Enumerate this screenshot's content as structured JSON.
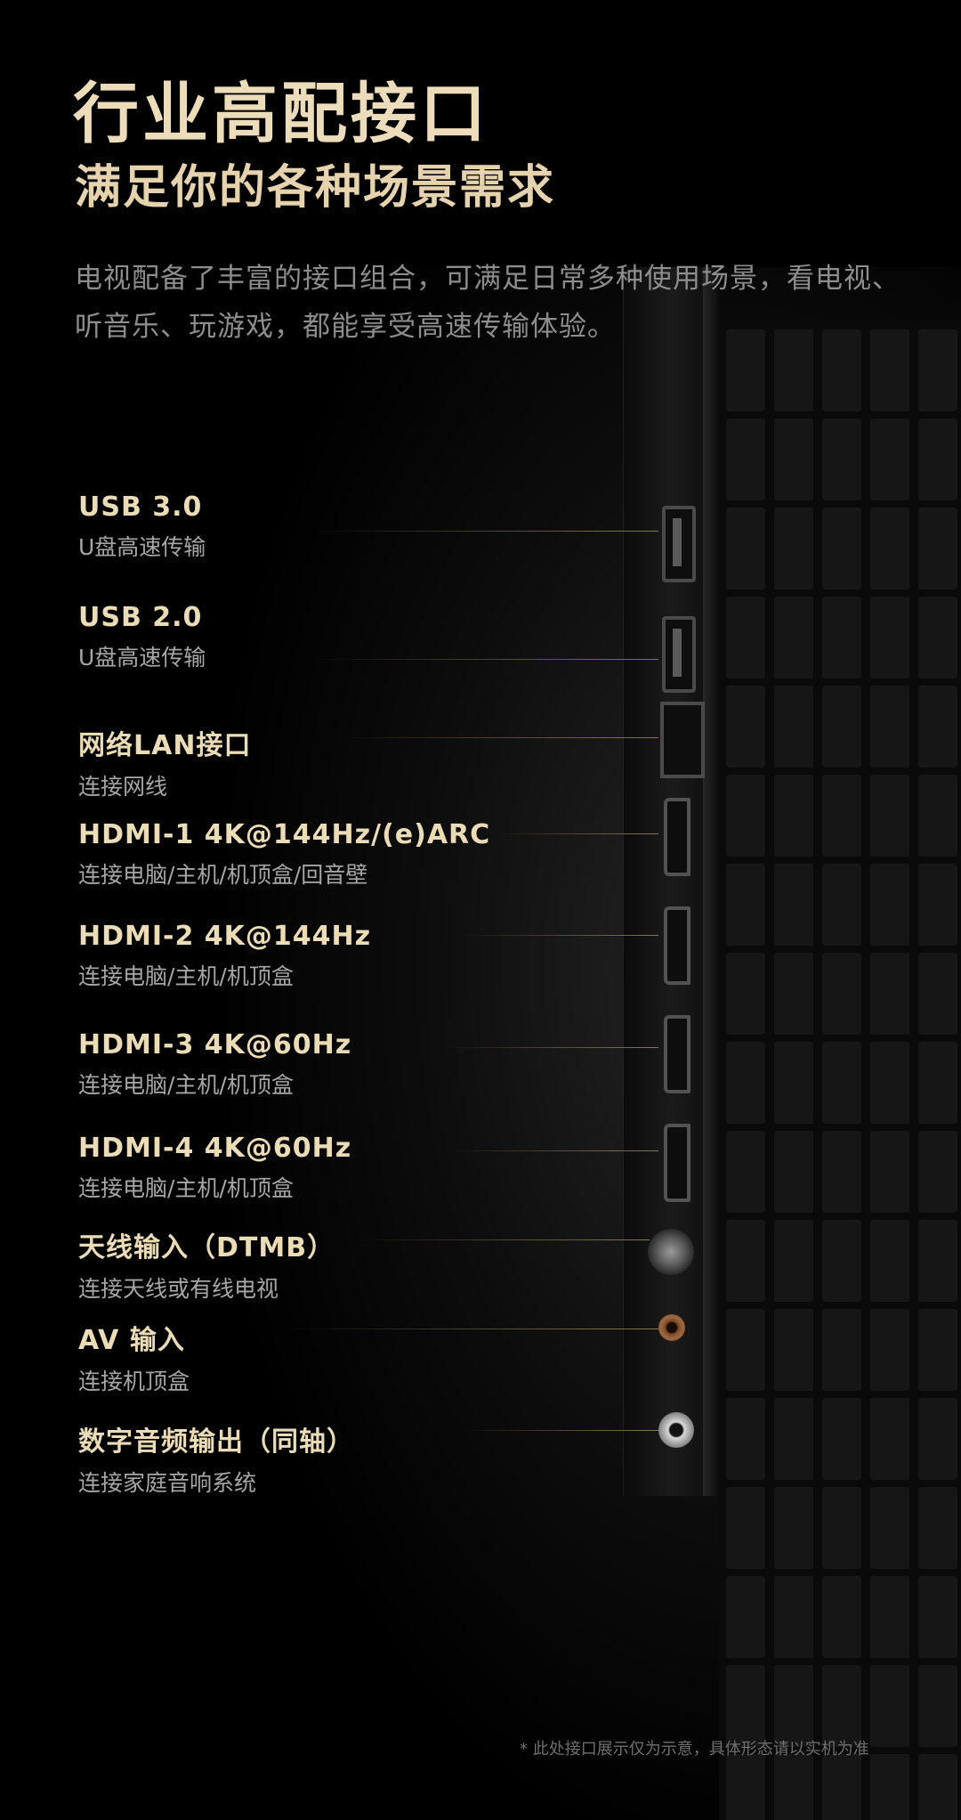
{
  "hero": {
    "title": "行业高配接口",
    "subtitle": "满足你的各种场景需求",
    "description": "电视配备了丰富的接口组合，可满足日常多种使用场景，看电视、听音乐、玩游戏，都能享受高速传输体验。"
  },
  "ports": [
    {
      "name": "USB 3.0",
      "desc": "U盘高速传输",
      "icon": "usb-port-icon"
    },
    {
      "name": "USB 2.0",
      "desc": "U盘高速传输",
      "icon": "usb-port-icon"
    },
    {
      "name": "网络LAN接口",
      "desc": "连接网线",
      "icon": "lan-port-icon"
    },
    {
      "name": "HDMI-1 4K@144Hz/(e)ARC",
      "desc": "连接电脑/主机/机顶盒/回音壁",
      "icon": "hdmi-port-icon"
    },
    {
      "name": "HDMI-2 4K@144Hz",
      "desc": "连接电脑/主机/机顶盒",
      "icon": "hdmi-port-icon"
    },
    {
      "name": "HDMI-3 4K@60Hz",
      "desc": "连接电脑/主机/机顶盒",
      "icon": "hdmi-port-icon"
    },
    {
      "name": "HDMI-4 4K@60Hz",
      "desc": "连接电脑/主机/机顶盒",
      "icon": "hdmi-port-icon"
    },
    {
      "name": "天线输入（DTMB）",
      "desc": "连接天线或有线电视",
      "icon": "antenna-port-icon"
    },
    {
      "name": "AV 输入",
      "desc": "连接机顶盒",
      "icon": "av-port-icon"
    },
    {
      "name": "数字音频输出（同轴）",
      "desc": "连接家庭音响系统",
      "icon": "coaxial-audio-port-icon"
    }
  ],
  "footnote": "* 此处接口展示仅为示意，具体形态请以实机为准",
  "colors": {
    "background": "#000000",
    "accent_gold": "#ecdcb9",
    "body_gray": "#8d8d8d"
  }
}
